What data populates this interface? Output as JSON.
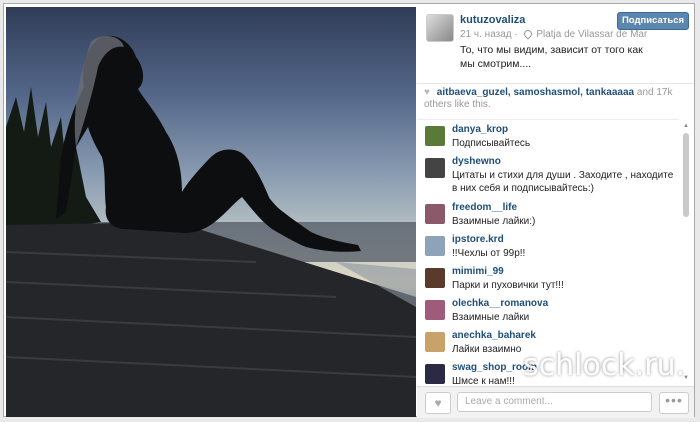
{
  "post": {
    "username": "kutuzovaliza",
    "time": "21 ч. назад",
    "separator": "·",
    "location": "Platja de Vilassar de Mar",
    "caption": "То, что мы видим, зависит от того как мы смотрим....",
    "subscribe_label": "Подписаться"
  },
  "likes": {
    "names": "aitbaeva_guzel, samoshasmol, tankaaaaa",
    "count_text": "and 17k",
    "others_text": "others like this."
  },
  "comments": [
    {
      "user": "danya_krop",
      "text": "Подписывайтесь",
      "avatar_color": "#5a7a3a"
    },
    {
      "user": "dyshewno",
      "text": "Цитаты и стихи для души . Заходите , находите в них себя и подписывайтесь:)",
      "avatar_color": "#444444"
    },
    {
      "user": "freedom__life",
      "text": "Взаимные лайки:)",
      "avatar_color": "#8a5a6a"
    },
    {
      "user": "ipstore.krd",
      "text": "!!Чехлы от 99р!!",
      "avatar_color": "#8fa3b8"
    },
    {
      "user": "mimimi_99",
      "text": "Парки и пуховички тут!!!",
      "avatar_color": "#5a3a2a"
    },
    {
      "user": "olechka__romanova",
      "text": "Взаимные лайки",
      "avatar_color": "#a05a7a"
    },
    {
      "user": "anechka_baharek",
      "text": "Лайки взаимно",
      "avatar_color": "#c9a26a"
    },
    {
      "user": "swag_shop_room",
      "text": "Шмсе к нам!!!",
      "avatar_color": "#2a2a44"
    }
  ],
  "footer": {
    "comment_placeholder": "Leave a comment...",
    "more_label": "•••"
  },
  "watermark": "schlock.ru."
}
